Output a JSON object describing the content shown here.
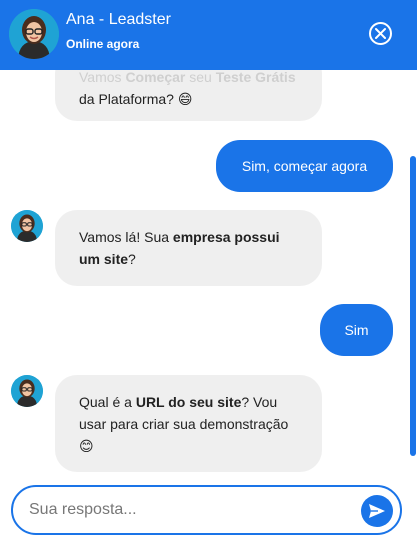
{
  "header": {
    "title": "Ana - Leadster",
    "status": "Online agora"
  },
  "messages": [
    {
      "from": "bot",
      "parts": [
        {
          "text": "Vamos ",
          "bold": false
        },
        {
          "text": "Começar",
          "bold": true
        },
        {
          "text": " seu ",
          "bold": false
        },
        {
          "text": "Teste Grátis",
          "bold": true
        },
        {
          "text": " da Plataforma? ",
          "bold": false
        },
        {
          "text": "😄",
          "bold": false
        }
      ]
    },
    {
      "from": "user",
      "text": "Sim, começar agora"
    },
    {
      "from": "bot",
      "parts": [
        {
          "text": "Vamos lá! ",
          "bold": false
        },
        {
          "text": "Sua ",
          "bold": false
        },
        {
          "text": "empresa possui um site",
          "bold": true
        },
        {
          "text": "?",
          "bold": false
        }
      ]
    },
    {
      "from": "user",
      "text": "Sim"
    },
    {
      "from": "bot",
      "parts": [
        {
          "text": "Qual é a ",
          "bold": false
        },
        {
          "text": "URL do seu site",
          "bold": true
        },
        {
          "text": "? Vou usar para criar sua demonstração ",
          "bold": false
        },
        {
          "text": "😊",
          "bold": false
        }
      ]
    }
  ],
  "input": {
    "placeholder": "Sua resposta..."
  },
  "colors": {
    "accent": "#1a74e8",
    "bot_bubble": "#efefef",
    "avatar_bg": "#1fa3d4"
  },
  "icons": {
    "close": "close-circle-icon",
    "send": "send-arrow-icon",
    "avatar": "agent-avatar"
  }
}
